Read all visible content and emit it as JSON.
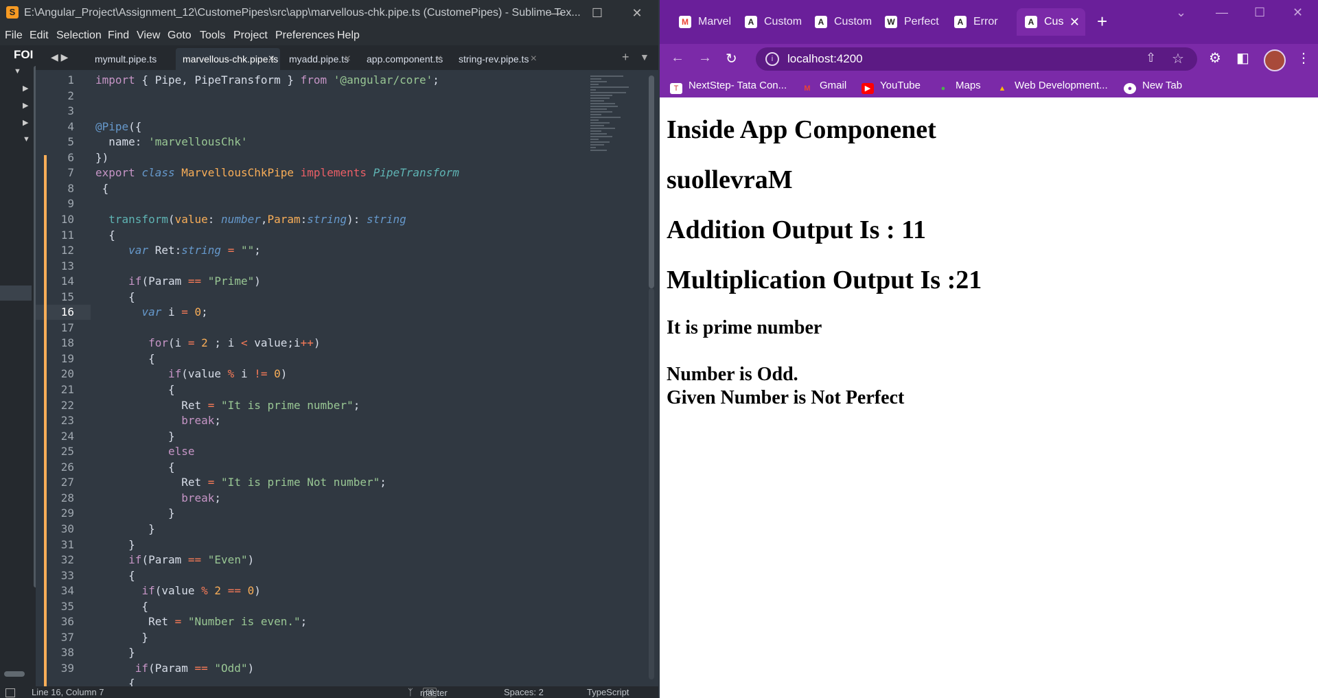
{
  "sublime": {
    "title": "E:\\Angular_Project\\Assignment_12\\CustomePipes\\src\\app\\marvellous-chk.pipe.ts (CustomePipes) - Sublime Tex...",
    "menu": [
      "File",
      "Edit",
      "Selection",
      "Find",
      "View",
      "Goto",
      "Tools",
      "Project",
      "Preferences",
      "Help"
    ],
    "sidebar_label": "FOI",
    "tabs": [
      "mymult.pipe.ts",
      "marvellous-chk.pipe.ts",
      "myadd.pipe.ts",
      "app.component.ts",
      "string-rev.pipe.ts"
    ],
    "active_tab": "marvellous-chk.pipe.ts",
    "line_numbers": [
      "1",
      "2",
      "3",
      "4",
      "5",
      "6",
      "7",
      "8",
      "9",
      "10",
      "11",
      "12",
      "13",
      "14",
      "15",
      "16",
      "17",
      "18",
      "19",
      "20",
      "21",
      "22",
      "23",
      "24",
      "25",
      "26",
      "27",
      "28",
      "29",
      "30",
      "31",
      "32",
      "33",
      "34",
      "35",
      "36",
      "37",
      "38",
      "39"
    ],
    "code": [
      "import { Pipe, PipeTransform } from '@angular/core';",
      "",
      "@Pipe({",
      "  name: 'marvellousChk'",
      "})",
      "export class MarvellousChkPipe implements PipeTransform",
      " {",
      "",
      "  transform(value: number,Param:string): string",
      "  {",
      "     var Ret:string = \"\";",
      "",
      "     if(Param == \"Prime\")",
      "     {",
      "       var i = 0;",
      "",
      "        for(i = 2 ; i < value;i++)",
      "        {",
      "           if(value % i != 0)",
      "           {",
      "             Ret = \"It is prime number\";",
      "             break;",
      "           }",
      "           else",
      "           {",
      "             Ret = \"It is prime Not number\";",
      "             break;",
      "           }",
      "        }",
      "     }",
      "     if(Param == \"Even\")",
      "     {",
      "       if(value % 2 == 0)",
      "       {",
      "        Ret = \"Number is even.\";",
      "       }",
      "     }",
      "      if(Param == \"Odd\")",
      "     {"
    ],
    "status": {
      "position": "Line 16, Column 7",
      "branch": "master",
      "branch_count": "68",
      "spaces": "Spaces: 2",
      "syntax": "TypeScript"
    }
  },
  "chrome": {
    "tabs": [
      {
        "label": "Marvell",
        "icon": "gmail-icon"
      },
      {
        "label": "Custom",
        "icon": "angular-icon"
      },
      {
        "label": "Custom",
        "icon": "angular-icon"
      },
      {
        "label": "Perfect",
        "icon": "wikipedia-icon"
      },
      {
        "label": "Error",
        "icon": "angular-icon"
      },
      {
        "label": "Cus",
        "icon": "angular-icon"
      }
    ],
    "url": "localhost:4200",
    "bookmarks": [
      {
        "label": "NextStep- Tata Con...",
        "icon": "tcs-icon"
      },
      {
        "label": "Gmail",
        "icon": "gmail-icon"
      },
      {
        "label": "YouTube",
        "icon": "youtube-icon"
      },
      {
        "label": "Maps",
        "icon": "maps-icon"
      },
      {
        "label": "Web Development...",
        "icon": "drive-icon"
      },
      {
        "label": "New Tab",
        "icon": "chrome-icon"
      }
    ],
    "content": {
      "h1": "Inside App Componenet",
      "reversed": "suollevraM",
      "addition": "Addition Output Is : 11",
      "multiplication": "Multiplication Output Is :21",
      "prime": "It is prime number",
      "odd": "Number is Odd.",
      "perfect": "Given Number is Not Perfect"
    }
  },
  "colors": {
    "chrome_accent": "#7b2aa8",
    "sublime_bg": "#303841",
    "gutter_mark": "#f9ae58"
  }
}
